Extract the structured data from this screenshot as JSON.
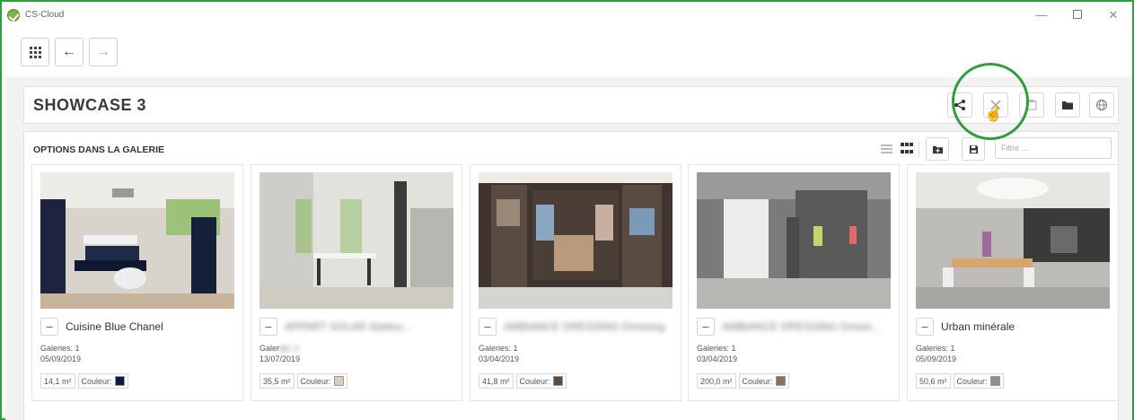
{
  "app": {
    "title": "CS-Cloud"
  },
  "window_controls": {
    "minimize": "—",
    "close": "✕"
  },
  "toolbar": {
    "back": "←",
    "forward": "→"
  },
  "header": {
    "title": "SHOWCASE 3"
  },
  "header_buttons": [
    "share-icon",
    "tools-icon",
    "export-icon",
    "folder-icon",
    "globe-icon"
  ],
  "gallery": {
    "section_title": "OPTIONS DANS LA GALERIE",
    "filter_placeholder": "Filtre ...",
    "cards": [
      {
        "name": "Cuisine Blue Chanel",
        "galleries": "Galeries: 1",
        "date": "05/09/2019",
        "area": "14,1 m²",
        "color_label": "Couleur:",
        "swatch": "#0e1a3a"
      },
      {
        "name": "APPART SOLAR Station...",
        "galleries": "Galer",
        "date": "13/07/2019",
        "area": "35,5 m²",
        "color_label": "Couleur:",
        "swatch": "#d9cfc0"
      },
      {
        "name": "AMBIANCE DRESSING Dressing",
        "galleries": "Galeries: 1",
        "date": "03/04/2019",
        "area": "41,8 m²",
        "color_label": "Couleur:",
        "swatch": "#5a4a3e"
      },
      {
        "name": "AMBIANCE DRESSING Dressi...",
        "galleries": "Galeries: 1",
        "date": "03/04/2019",
        "area": "200,0 m²",
        "color_label": "Couleur:",
        "swatch": "#8a7060"
      },
      {
        "name": "Urban minérale",
        "galleries": "Galeries: 1",
        "date": "05/09/2019",
        "area": "50,6 m²",
        "color_label": "Couleur:",
        "swatch": "#8e8e8e"
      }
    ]
  }
}
